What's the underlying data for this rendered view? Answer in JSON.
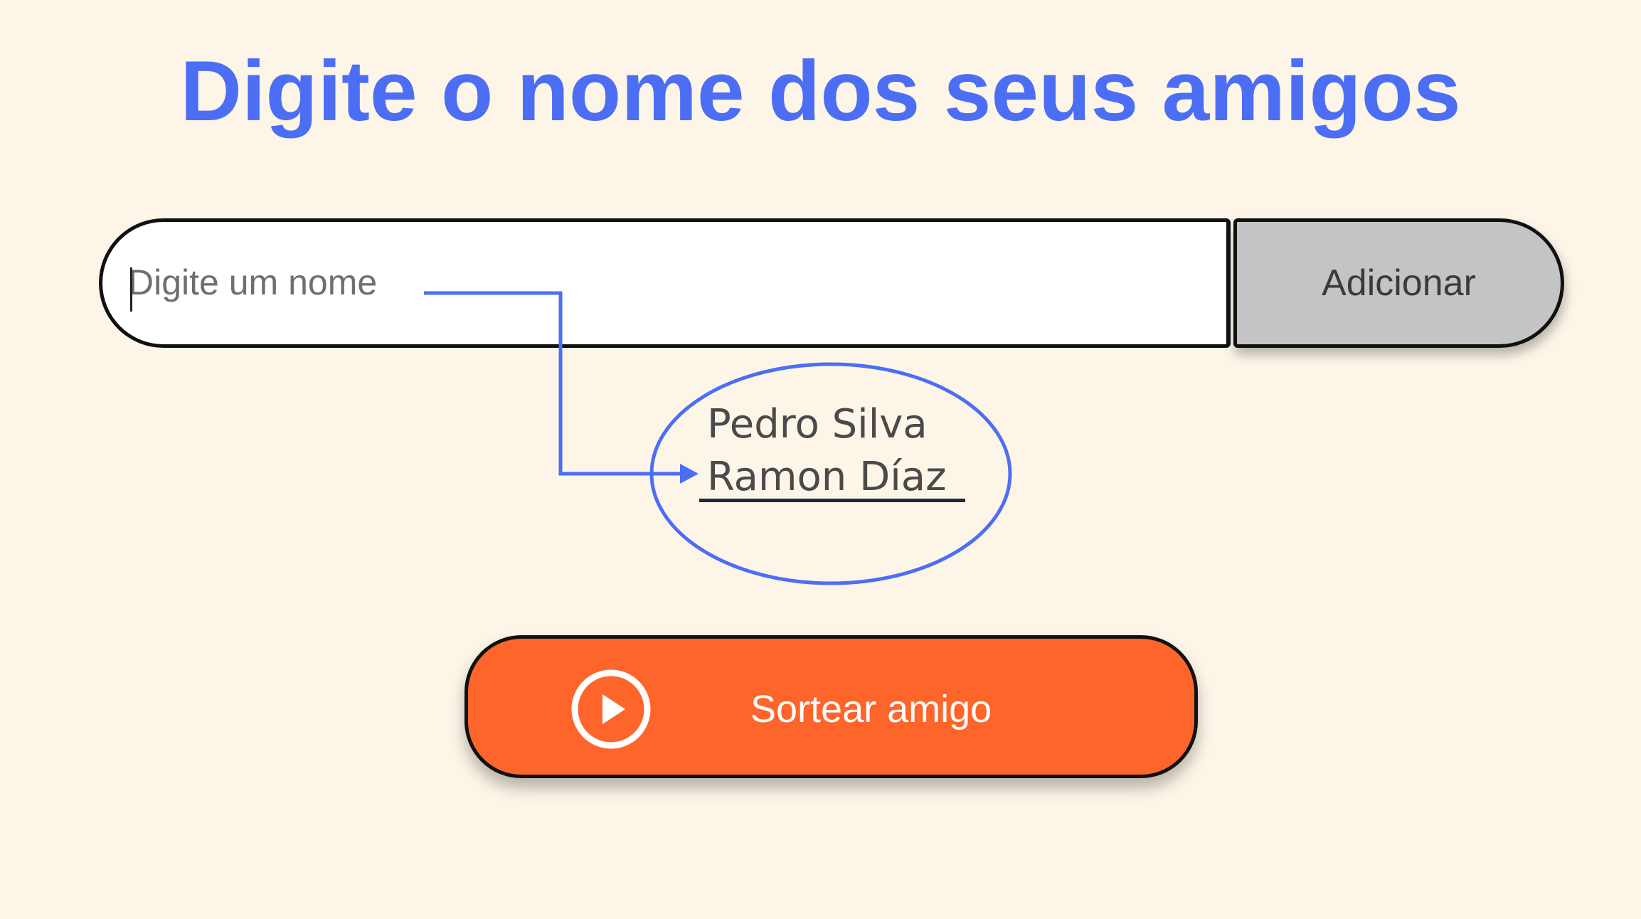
{
  "colors": {
    "background": "#fdf6e8",
    "title": "#4c6ef5",
    "annotation": "#4c6ef5",
    "input_background": "#ffffff",
    "add_button_background": "#c4c4c4",
    "draw_button_background": "#fe652b"
  },
  "header": {
    "title": "Digite o nome dos seus amigos"
  },
  "form": {
    "input_placeholder": "Digite um nome",
    "input_value": "",
    "add_button_label": "Adicionar"
  },
  "friends_list": {
    "items": [
      "Pedro Silva",
      "Ramon Díaz"
    ]
  },
  "draw_button": {
    "label": "Sortear amigo",
    "icon": "play-circle-icon"
  }
}
